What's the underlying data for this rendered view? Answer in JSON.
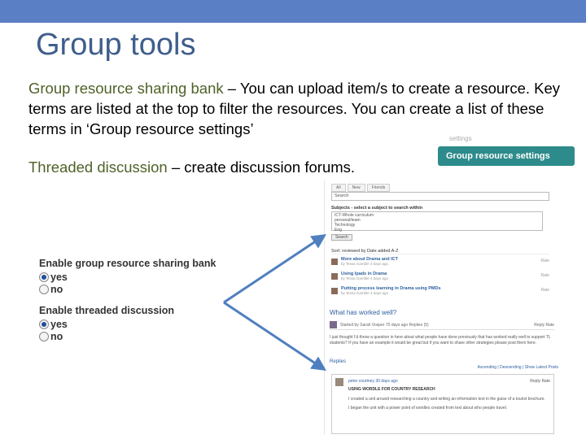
{
  "slide": {
    "title": "Group tools",
    "p1": {
      "term": "Group resource sharing bank",
      "text": " – You can upload item/s to create a resource. Key terms are listed at the top to filter the resources. You can create a list of these terms in ‘Group resource settings’"
    },
    "p2": {
      "term": "Threaded discussion",
      "text": " – create discussion forums."
    }
  },
  "settings_badge": {
    "faint": "settings",
    "label": "Group resource settings",
    "color": "#2e8b8b"
  },
  "options": {
    "resource_bank": {
      "heading": "Enable group resource sharing bank",
      "yes": "yes",
      "no": "no"
    },
    "threaded": {
      "heading": "Enable threaded discussion",
      "yes": "yes",
      "no": "no"
    }
  },
  "screenshot": {
    "tabs": [
      "All",
      "New",
      "Friends"
    ],
    "search": "Search",
    "subjects_label": "Subjects - select a subject to search within",
    "subjects": [
      "ICT-Whole curriculum",
      "personal/team",
      "Technology",
      "Eng"
    ],
    "search_button": "Search",
    "sort": "Sort: reviewed by  Date added  A-Z",
    "resources": [
      {
        "title": "More about Drama and ICT",
        "sub": "by Tessa Gamble 4 days ago",
        "rating": "Rate"
      },
      {
        "title": "Using Ipads in Drama",
        "sub": "by Tessa Gamble 4 days ago",
        "rating": "Rate"
      },
      {
        "title": "Putting process learning in Drama using PMDs",
        "sub": "by Tessa Gamble 4 days ago",
        "rating": "Rate"
      }
    ],
    "discussion": {
      "title": "What has worked well?",
      "starter": "Started by Sarah Vosper  70 days ago  Replies (5)",
      "reply_tools": "Reply  Rate",
      "text": "I just thought I'd throw a question in here about what people have done previously that has worked really well to support TL students? If you have an example it would be great but if you want to share other strategies please post them here.",
      "replies_label": "Replies",
      "sort_options": "Ascending | Descending | Show Latest Posts"
    },
    "reply": {
      "author": "peter courtney  30 days ago",
      "tools": "Reply  Rate",
      "title": "USING WORDLE FOR COUNTRY RESEARCH",
      "text1": "I created a unit around researching a country and writing an information text in the guise of a tourist brochure.",
      "text2": "I began the unit with a power point of wordles created from text about who people travel."
    }
  },
  "colors": {
    "top_bar": "#5b7fc4",
    "title": "#3f5e8c",
    "term": "#4f6228",
    "arrow": "#4f7fbf"
  }
}
